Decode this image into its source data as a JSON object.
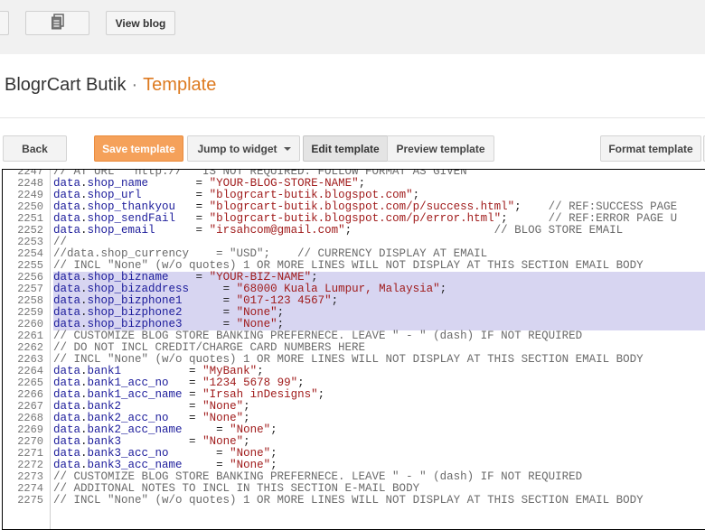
{
  "topbar": {
    "view_blog_label": "View blog",
    "pages_icon": "pages-icon"
  },
  "header": {
    "blog_name": "BlogrCart Butik",
    "separator": "·",
    "section": "Template"
  },
  "toolbar": {
    "back_label": "Back",
    "save_label": "Save template",
    "jump_label": "Jump to widget",
    "edit_label": "Edit template",
    "preview_label": "Preview template",
    "format_label": "Format template"
  },
  "colors": {
    "accent": "#dd7a20",
    "save_button": "#f5a15a",
    "selection": "#d7d5f1",
    "identifier": "#1c1c9b",
    "string": "#a01b1b"
  },
  "editor": {
    "selected_lines": [
      2256,
      2257,
      2258,
      2259,
      2260
    ],
    "lines": [
      {
        "n": "2247",
        "parts": [
          [
            "com",
            "// AT URL \" http:// \" IS NOT REQUIRED. FOLLOW FORMAT AS GIVEN"
          ]
        ]
      },
      {
        "n": "2248",
        "parts": [
          [
            "id",
            "data"
          ],
          [
            "op",
            "."
          ],
          [
            "id",
            "shop_name"
          ],
          [
            "op",
            "       = "
          ],
          [
            "str",
            "\"YOUR-BLOG-STORE-NAME\""
          ],
          [
            "op",
            ";"
          ]
        ]
      },
      {
        "n": "2249",
        "parts": [
          [
            "id",
            "data"
          ],
          [
            "op",
            "."
          ],
          [
            "id",
            "shop_url"
          ],
          [
            "op",
            "        = "
          ],
          [
            "str",
            "\"blogrcart-butik.blogspot.com\""
          ],
          [
            "op",
            ";"
          ]
        ]
      },
      {
        "n": "2250",
        "parts": [
          [
            "id",
            "data"
          ],
          [
            "op",
            "."
          ],
          [
            "id",
            "shop_thankyou"
          ],
          [
            "op",
            "   = "
          ],
          [
            "str",
            "\"blogrcart-butik.blogspot.com/p/success.html\""
          ],
          [
            "op",
            ";    "
          ],
          [
            "com",
            "// REF:SUCCESS PAGE"
          ]
        ]
      },
      {
        "n": "2251",
        "parts": [
          [
            "id",
            "data"
          ],
          [
            "op",
            "."
          ],
          [
            "id",
            "shop_sendFail"
          ],
          [
            "op",
            "   = "
          ],
          [
            "str",
            "\"blogrcart-butik.blogspot.com/p/error.html\""
          ],
          [
            "op",
            ";      "
          ],
          [
            "com",
            "// REF:ERROR PAGE U"
          ]
        ]
      },
      {
        "n": "2252",
        "parts": [
          [
            "id",
            "data"
          ],
          [
            "op",
            "."
          ],
          [
            "id",
            "shop_email"
          ],
          [
            "op",
            "      = "
          ],
          [
            "str",
            "\"irsahcom@gmail.com\""
          ],
          [
            "op",
            ";                     "
          ],
          [
            "com",
            "// BLOG STORE EMAIL"
          ]
        ]
      },
      {
        "n": "2253",
        "parts": [
          [
            "com",
            "//"
          ]
        ]
      },
      {
        "n": "2254",
        "parts": [
          [
            "com",
            "//data.shop_currency    = \"USD\";    // CURRENCY DISPLAY AT EMAIL"
          ]
        ]
      },
      {
        "n": "2255",
        "parts": [
          [
            "com",
            "// INCL \"None\" (w/o quotes) 1 OR MORE LINES WILL NOT DISPLAY AT THIS SECTION EMAIL BODY"
          ]
        ]
      },
      {
        "n": "2256",
        "parts": [
          [
            "id",
            "data"
          ],
          [
            "op",
            "."
          ],
          [
            "id",
            "shop_bizname"
          ],
          [
            "op",
            "    = "
          ],
          [
            "str",
            "\"YOUR-BIZ-NAME\""
          ],
          [
            "op",
            ";"
          ]
        ]
      },
      {
        "n": "2257",
        "parts": [
          [
            "id",
            "data"
          ],
          [
            "op",
            "."
          ],
          [
            "id",
            "shop_bizaddress"
          ],
          [
            "op",
            "     = "
          ],
          [
            "str",
            "\"68000 Kuala Lumpur, Malaysia\""
          ],
          [
            "op",
            ";"
          ]
        ]
      },
      {
        "n": "2258",
        "parts": [
          [
            "id",
            "data"
          ],
          [
            "op",
            "."
          ],
          [
            "id",
            "shop_bizphone1"
          ],
          [
            "op",
            "      = "
          ],
          [
            "str",
            "\"017-123 4567\""
          ],
          [
            "op",
            ";"
          ]
        ]
      },
      {
        "n": "2259",
        "parts": [
          [
            "id",
            "data"
          ],
          [
            "op",
            "."
          ],
          [
            "id",
            "shop_bizphone2"
          ],
          [
            "op",
            "      = "
          ],
          [
            "str",
            "\"None\""
          ],
          [
            "op",
            ";"
          ]
        ]
      },
      {
        "n": "2260",
        "parts": [
          [
            "id",
            "data"
          ],
          [
            "op",
            "."
          ],
          [
            "id",
            "shop_bizphone3"
          ],
          [
            "op",
            "      = "
          ],
          [
            "str",
            "\"None\""
          ],
          [
            "op",
            ";"
          ]
        ]
      },
      {
        "n": "2261",
        "parts": [
          [
            "com",
            "// CUSTOMIZE BLOG STORE BANKING PREFERNECE. LEAVE \" - \" (dash) IF NOT REQUIRED"
          ]
        ]
      },
      {
        "n": "2262",
        "parts": [
          [
            "com",
            "// DO NOT INCL CREDIT/CHARGE CARD NUMBERS HERE"
          ]
        ]
      },
      {
        "n": "2263",
        "parts": [
          [
            "com",
            "// INCL \"None\" (w/o quotes) 1 OR MORE LINES WILL NOT DISPLAY AT THIS SECTION EMAIL BODY"
          ]
        ]
      },
      {
        "n": "2264",
        "parts": [
          [
            "id",
            "data"
          ],
          [
            "op",
            "."
          ],
          [
            "id",
            "bank1"
          ],
          [
            "op",
            "          = "
          ],
          [
            "str",
            "\"MyBank\""
          ],
          [
            "op",
            ";"
          ]
        ]
      },
      {
        "n": "2265",
        "parts": [
          [
            "id",
            "data"
          ],
          [
            "op",
            "."
          ],
          [
            "id",
            "bank1_acc_no"
          ],
          [
            "op",
            "   = "
          ],
          [
            "str",
            "\"1234 5678 99\""
          ],
          [
            "op",
            ";"
          ]
        ]
      },
      {
        "n": "2266",
        "parts": [
          [
            "id",
            "data"
          ],
          [
            "op",
            "."
          ],
          [
            "id",
            "bank1_acc_name"
          ],
          [
            "op",
            " = "
          ],
          [
            "str",
            "\"Irsah inDesigns\""
          ],
          [
            "op",
            ";"
          ]
        ]
      },
      {
        "n": "2267",
        "parts": [
          [
            "id",
            "data"
          ],
          [
            "op",
            "."
          ],
          [
            "id",
            "bank2"
          ],
          [
            "op",
            "          = "
          ],
          [
            "str",
            "\"None\""
          ],
          [
            "op",
            ";"
          ]
        ]
      },
      {
        "n": "2268",
        "parts": [
          [
            "id",
            "data"
          ],
          [
            "op",
            "."
          ],
          [
            "id",
            "bank2_acc_no"
          ],
          [
            "op",
            "   = "
          ],
          [
            "str",
            "\"None\""
          ],
          [
            "op",
            ";"
          ]
        ]
      },
      {
        "n": "2269",
        "parts": [
          [
            "id",
            "data"
          ],
          [
            "op",
            "."
          ],
          [
            "id",
            "bank2_acc_name"
          ],
          [
            "op",
            "     = "
          ],
          [
            "str",
            "\"None\""
          ],
          [
            "op",
            ";"
          ]
        ]
      },
      {
        "n": "2270",
        "parts": [
          [
            "id",
            "data"
          ],
          [
            "op",
            "."
          ],
          [
            "id",
            "bank3"
          ],
          [
            "op",
            "          = "
          ],
          [
            "str",
            "\"None\""
          ],
          [
            "op",
            ";"
          ]
        ]
      },
      {
        "n": "2271",
        "parts": [
          [
            "id",
            "data"
          ],
          [
            "op",
            "."
          ],
          [
            "id",
            "bank3_acc_no"
          ],
          [
            "op",
            "       = "
          ],
          [
            "str",
            "\"None\""
          ],
          [
            "op",
            ";"
          ]
        ]
      },
      {
        "n": "2272",
        "parts": [
          [
            "id",
            "data"
          ],
          [
            "op",
            "."
          ],
          [
            "id",
            "bank3_acc_name"
          ],
          [
            "op",
            "     = "
          ],
          [
            "str",
            "\"None\""
          ],
          [
            "op",
            ";"
          ]
        ]
      },
      {
        "n": "2273",
        "parts": [
          [
            "com",
            "// CUSTOMIZE BLOG STORE BANKING PREFERNECE. LEAVE \" - \" (dash) IF NOT REQUIRED"
          ]
        ]
      },
      {
        "n": "2274",
        "parts": [
          [
            "com",
            "// ADDITONAL NOTES TO INCL IN THIS SECTION E-MAIL BODY"
          ]
        ]
      },
      {
        "n": "2275",
        "parts": [
          [
            "com",
            "// INCL \"None\" (w/o quotes) 1 OR MORE LINES WILL NOT DISPLAY AT THIS SECTION EMAIL BODY"
          ]
        ]
      }
    ]
  }
}
